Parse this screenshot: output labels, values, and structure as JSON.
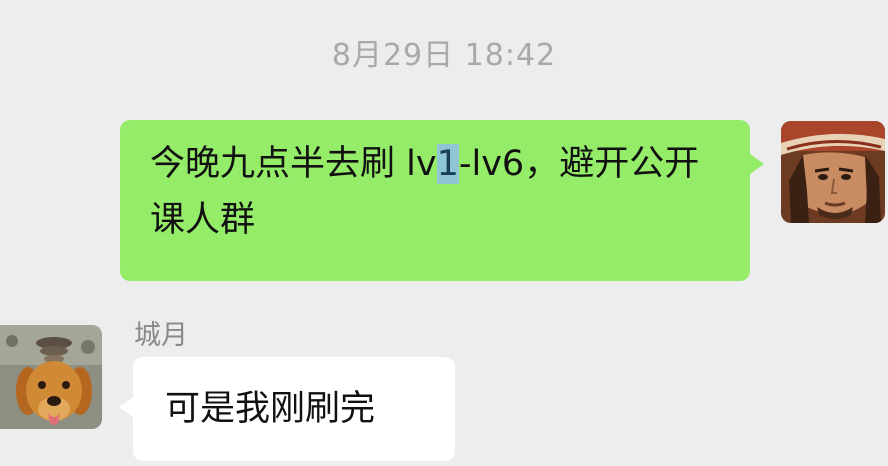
{
  "chat": {
    "timestamp": "8月29日 18:42",
    "messages": [
      {
        "direction": "sent",
        "text_before": "今晚九点半去刷 lv",
        "selected_text": "1",
        "text_after": "-lv6，避开公开课人群"
      },
      {
        "direction": "received",
        "sender": "城月",
        "text": "可是我刚刷完"
      }
    ]
  },
  "colors": {
    "background": "#ededed",
    "sent_bubble": "#95ec69",
    "received_bubble": "#ffffff",
    "selection_highlight": "#8ec6d6",
    "timestamp_text": "#a9a9a9"
  },
  "icons": {
    "self_avatar": "pirate-avatar-icon",
    "friend_avatar": "golden-retriever-avatar-icon"
  }
}
